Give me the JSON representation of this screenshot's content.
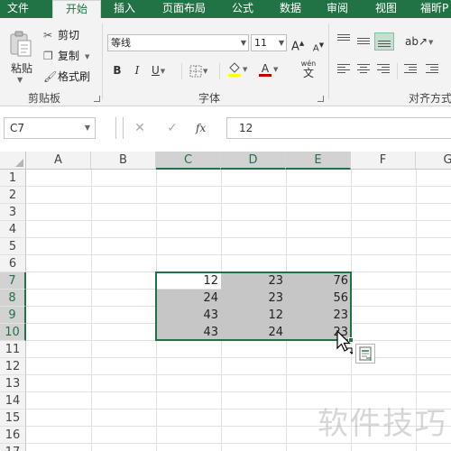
{
  "ribbon_tabs": [
    "文件",
    "开始",
    "插入",
    "页面布局",
    "公式",
    "数据",
    "审阅",
    "视图",
    "福昕P"
  ],
  "active_tab": "开始",
  "clipboard": {
    "paste": "粘贴",
    "cut": "剪切",
    "copy": "复制",
    "format_painter": "格式刷",
    "group_label": "剪贴板"
  },
  "font": {
    "name": "等线",
    "size": "11",
    "grow": "A",
    "shrink": "A",
    "bold": "B",
    "italic": "I",
    "underline": "U",
    "font_color_letter": "A",
    "wen_top": "wén",
    "wen_char": "文",
    "group_label": "字体"
  },
  "alignment": {
    "group_label": "对齐方式"
  },
  "name_box": "C7",
  "formula_fx": "fx",
  "formula_value": "12",
  "columns": [
    "A",
    "B",
    "C",
    "D",
    "E",
    "F",
    "G"
  ],
  "selected_columns": [
    "C",
    "D",
    "E"
  ],
  "rows": [
    "1",
    "2",
    "3",
    "4",
    "5",
    "6",
    "7",
    "8",
    "9",
    "10",
    "11",
    "12",
    "13",
    "14",
    "15",
    "16",
    "17"
  ],
  "selected_rows": [
    "7",
    "8",
    "9",
    "10"
  ],
  "cells": {
    "C7": "12",
    "D7": "23",
    "E7": "76",
    "C8": "24",
    "D8": "23",
    "E8": "56",
    "C9": "43",
    "D9": "12",
    "E9": "23",
    "C10": "43",
    "D10": "24",
    "E10": "23"
  },
  "colors": {
    "excel_green": "#217346",
    "selection_shade": "#c6c6c6",
    "header_selected": "#d2d2d2",
    "font_color_bar": "#c00000",
    "fill_color_bar": "#ffff00"
  },
  "watermark": "软件技巧",
  "icons": [
    "scissors-icon",
    "copy-icon",
    "paintbrush-icon",
    "paste-icon",
    "cancel-icon",
    "enter-icon",
    "fx-icon",
    "quick-analysis-icon",
    "cursor-icon"
  ]
}
